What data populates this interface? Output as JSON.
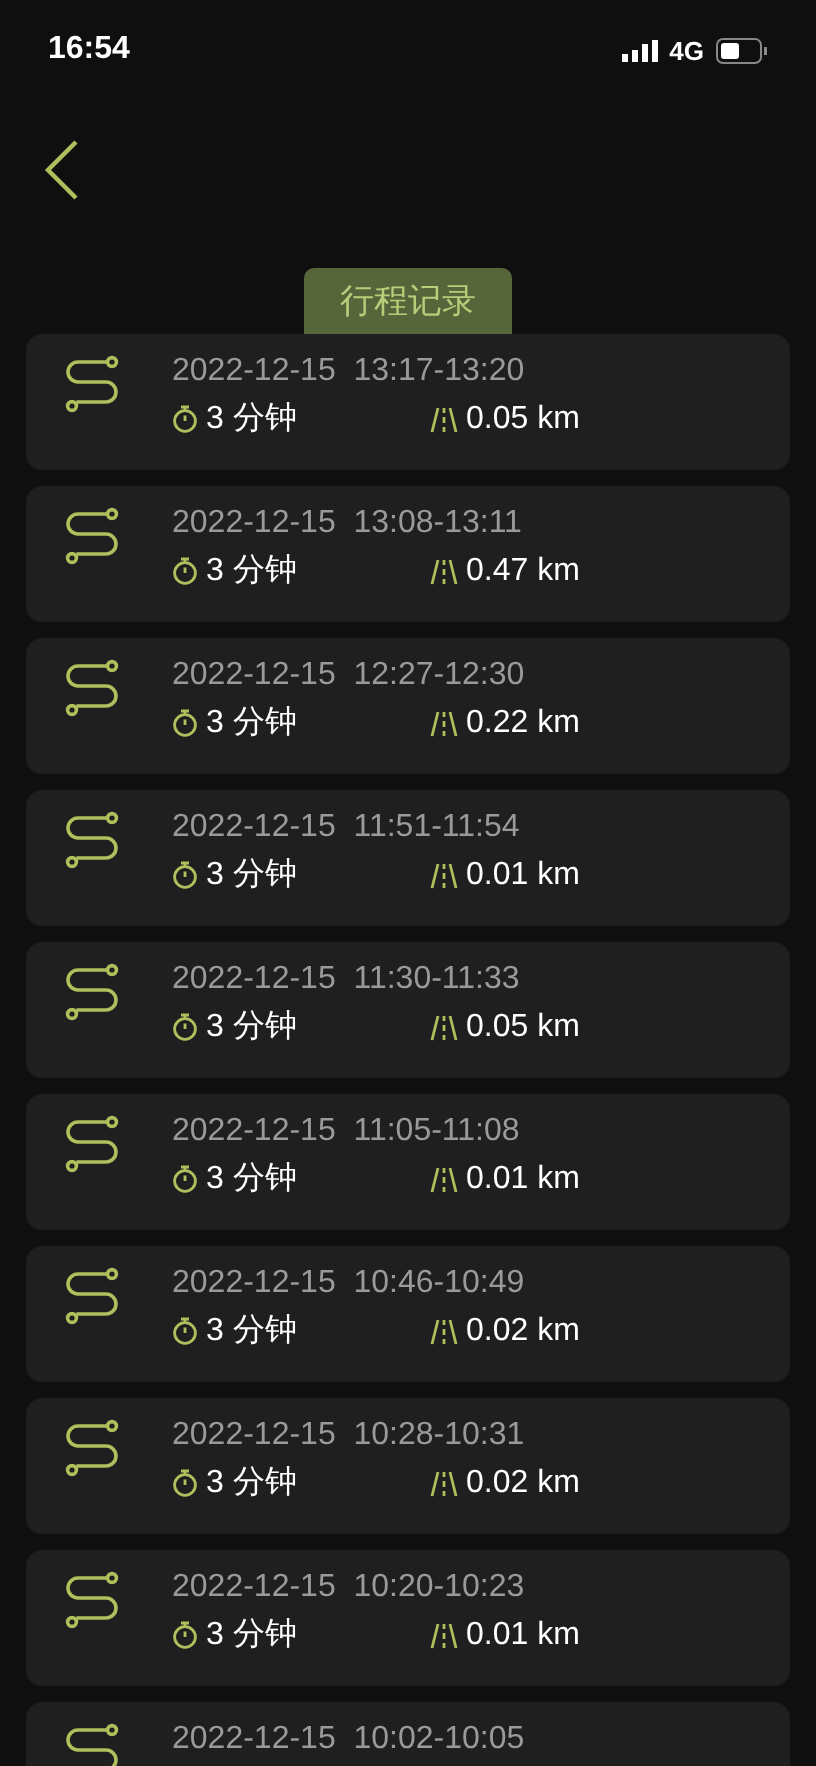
{
  "status_bar": {
    "time": "16:54",
    "network": "4G"
  },
  "title": "行程记录",
  "trips": [
    {
      "datetime": "2022-12-15  13:17-13:20",
      "duration": "3 分钟",
      "distance": "0.05 km"
    },
    {
      "datetime": "2022-12-15  13:08-13:11",
      "duration": "3 分钟",
      "distance": "0.47 km"
    },
    {
      "datetime": "2022-12-15  12:27-12:30",
      "duration": "3 分钟",
      "distance": "0.22 km"
    },
    {
      "datetime": "2022-12-15  11:51-11:54",
      "duration": "3 分钟",
      "distance": "0.01 km"
    },
    {
      "datetime": "2022-12-15  11:30-11:33",
      "duration": "3 分钟",
      "distance": "0.05 km"
    },
    {
      "datetime": "2022-12-15  11:05-11:08",
      "duration": "3 分钟",
      "distance": "0.01 km"
    },
    {
      "datetime": "2022-12-15  10:46-10:49",
      "duration": "3 分钟",
      "distance": "0.02 km"
    },
    {
      "datetime": "2022-12-15  10:28-10:31",
      "duration": "3 分钟",
      "distance": "0.02 km"
    },
    {
      "datetime": "2022-12-15  10:20-10:23",
      "duration": "3 分钟",
      "distance": "0.01 km"
    },
    {
      "datetime": "2022-12-15  10:02-10:05"
    }
  ]
}
